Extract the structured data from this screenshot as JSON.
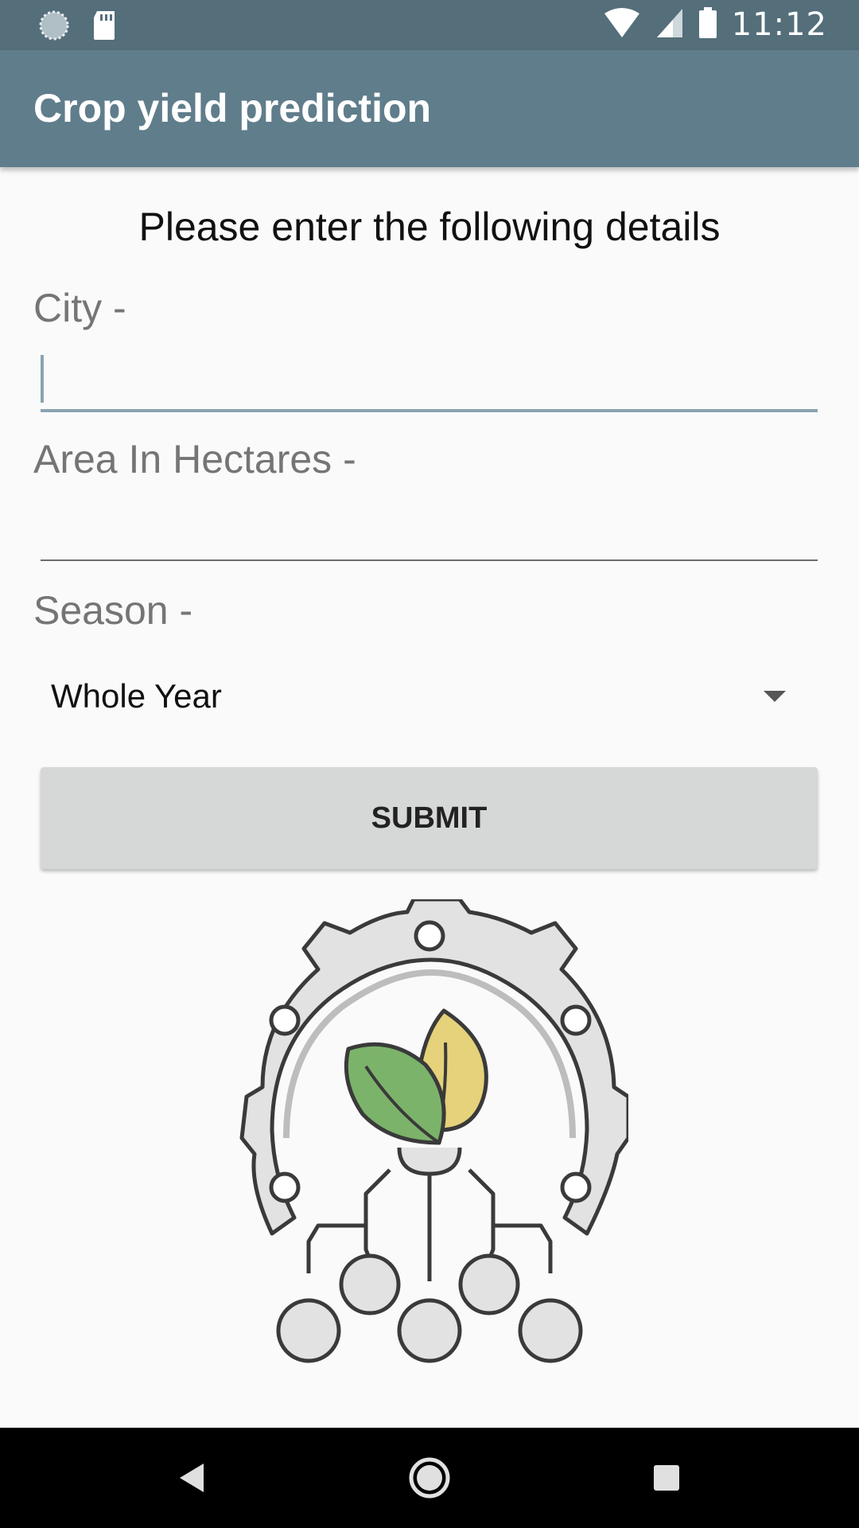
{
  "status_bar": {
    "time": "11:12",
    "icons": [
      "sync-icon",
      "sd-card-icon",
      "wifi-icon",
      "signal-icon",
      "battery-icon"
    ]
  },
  "app_bar": {
    "title": "Crop yield prediction"
  },
  "form": {
    "heading": "Please enter the following details",
    "city_label": "City -",
    "city_value": "",
    "area_label": "Area In Hectares -",
    "area_value": "",
    "season_label": "Season -",
    "season_value": "Whole Year",
    "submit_label": "SUBMIT"
  },
  "logo": {
    "icon": "gear-leaf-network-logo",
    "colors": {
      "gear": "#e0e0e0",
      "outline": "#3a3a3a",
      "leaf_green": "#7cb36a",
      "leaf_yellow": "#e5d27a"
    }
  },
  "nav_bar": {
    "icons": [
      "back-icon",
      "home-icon",
      "recents-icon"
    ]
  },
  "colors": {
    "status_bar": "#546e7a",
    "app_bar": "#607d8b",
    "accent": "#8aa4b1",
    "button": "#d6d7d7"
  }
}
